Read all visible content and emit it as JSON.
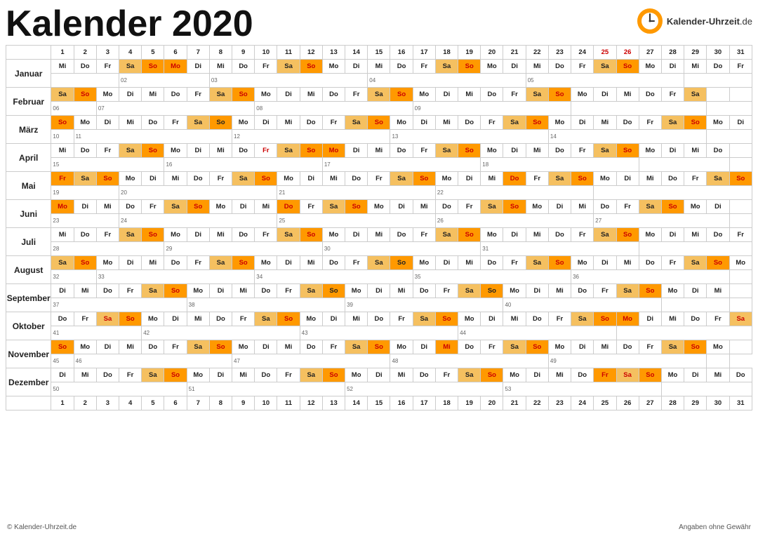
{
  "title": "Kalender 2020",
  "logo": {
    "name": "Kalender-Uhrzeit.de",
    "icon_color": "#f90"
  },
  "footer": {
    "left": "© Kalender-Uhrzeit.de",
    "right": "Angaben ohne Gewähr"
  },
  "months": [
    {
      "name": "Januar"
    },
    {
      "name": "Februar"
    },
    {
      "name": "März"
    },
    {
      "name": "April"
    },
    {
      "name": "Mai"
    },
    {
      "name": "Juni"
    },
    {
      "name": "Juli"
    },
    {
      "name": "August"
    },
    {
      "name": "September"
    },
    {
      "name": "Oktober"
    },
    {
      "name": "November"
    },
    {
      "name": "Dezember"
    }
  ]
}
